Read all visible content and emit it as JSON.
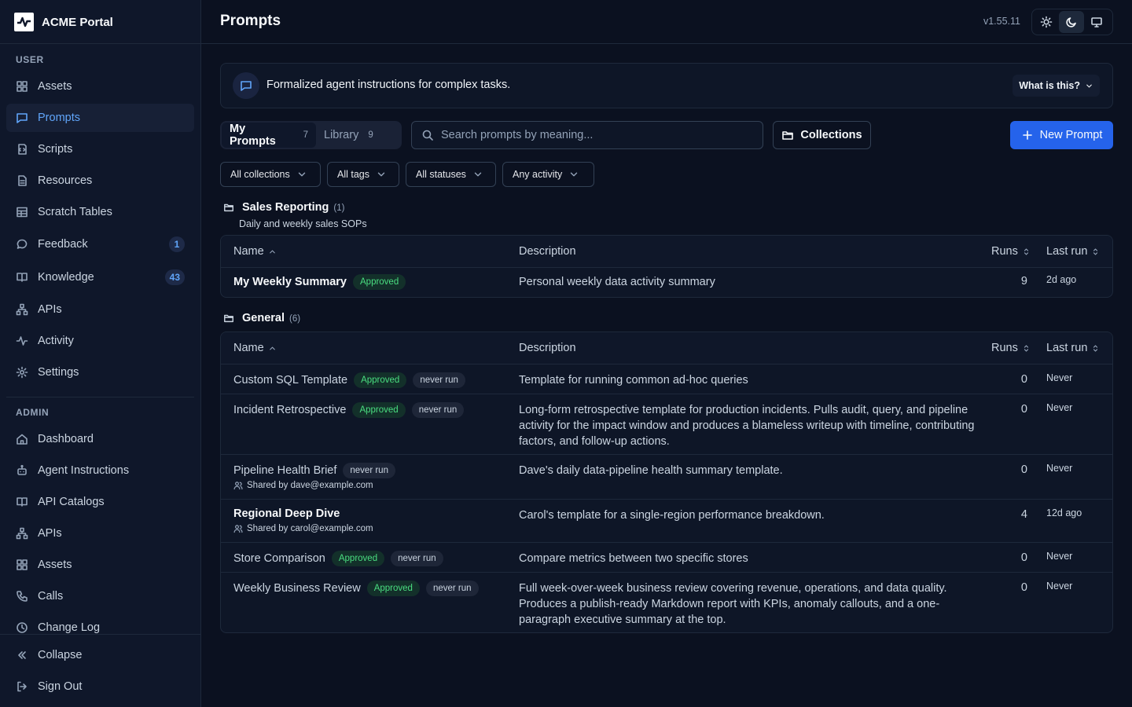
{
  "app": {
    "name": "ACME Portal"
  },
  "sidebar": {
    "user_label": "USER",
    "user_items": [
      {
        "label": "Assets",
        "icon": "grid-icon"
      },
      {
        "label": "Prompts",
        "icon": "message-icon",
        "active": true
      },
      {
        "label": "Scripts",
        "icon": "script-icon"
      },
      {
        "label": "Resources",
        "icon": "file-icon"
      },
      {
        "label": "Scratch Tables",
        "icon": "table-icon"
      },
      {
        "label": "Feedback",
        "icon": "chat-icon",
        "badge": "1"
      },
      {
        "label": "Knowledge",
        "icon": "book-icon",
        "badge": "43"
      },
      {
        "label": "APIs",
        "icon": "network-icon"
      },
      {
        "label": "Activity",
        "icon": "pulse-icon"
      },
      {
        "label": "Settings",
        "icon": "gear-icon"
      }
    ],
    "admin_label": "ADMIN",
    "admin_items": [
      {
        "label": "Dashboard",
        "icon": "home-icon"
      },
      {
        "label": "Agent Instructions",
        "icon": "robot-icon"
      },
      {
        "label": "API Catalogs",
        "icon": "book-icon"
      },
      {
        "label": "APIs",
        "icon": "network-icon"
      },
      {
        "label": "Assets",
        "icon": "grid-icon"
      },
      {
        "label": "Calls",
        "icon": "phone-icon"
      },
      {
        "label": "Change Log",
        "icon": "clock-icon"
      }
    ],
    "collapse_label": "Collapse",
    "signout_label": "Sign Out"
  },
  "header": {
    "title": "Prompts",
    "version": "v1.55.11",
    "theme_active": "dark"
  },
  "banner": {
    "text": "Formalized agent instructions for complex tasks.",
    "help_label": "What is this?"
  },
  "tabs": [
    {
      "label": "My Prompts",
      "count": "7",
      "active": true
    },
    {
      "label": "Library",
      "count": "9",
      "active": false
    }
  ],
  "search": {
    "placeholder": "Search prompts by meaning...",
    "value": ""
  },
  "collections_label": "Collections",
  "new_prompt_label": "New Prompt",
  "filters": [
    "All collections",
    "All tags",
    "All statuses",
    "Any activity"
  ],
  "columns": {
    "name": "Name",
    "description": "Description",
    "runs": "Runs",
    "last_run": "Last run"
  },
  "groups": [
    {
      "name": "Sales Reporting",
      "count": "(1)",
      "subtitle": "Daily and weekly sales SOPs",
      "rows": [
        {
          "name": "My Weekly Summary",
          "bold": true,
          "approved": "Approved",
          "never_run": null,
          "shared": null,
          "description": "Personal weekly data activity summary",
          "runs": "9",
          "last_run": "2d ago"
        }
      ]
    },
    {
      "name": "General",
      "count": "(6)",
      "subtitle": "",
      "rows": [
        {
          "name": "Custom SQL Template",
          "bold": false,
          "approved": "Approved",
          "never_run": "never run",
          "shared": null,
          "description": "Template for running common ad-hoc queries",
          "runs": "0",
          "last_run": "Never"
        },
        {
          "name": "Incident Retrospective",
          "bold": false,
          "approved": "Approved",
          "never_run": "never run",
          "shared": null,
          "description": "Long-form retrospective template for production incidents. Pulls audit, query, and pipeline activity for the impact window and produces a blameless writeup with timeline, contributing factors, and follow-up actions.",
          "runs": "0",
          "last_run": "Never"
        },
        {
          "name": "Pipeline Health Brief",
          "bold": false,
          "approved": null,
          "never_run": "never run",
          "shared": "Shared by dave@example.com",
          "description": "Dave's daily data-pipeline health summary template.",
          "runs": "0",
          "last_run": "Never"
        },
        {
          "name": "Regional Deep Dive",
          "bold": true,
          "approved": null,
          "never_run": null,
          "shared": "Shared by carol@example.com",
          "description": "Carol's template for a single-region performance breakdown.",
          "runs": "4",
          "last_run": "12d ago"
        },
        {
          "name": "Store Comparison",
          "bold": false,
          "approved": "Approved",
          "never_run": "never run",
          "shared": null,
          "description": "Compare metrics between two specific stores",
          "runs": "0",
          "last_run": "Never"
        },
        {
          "name": "Weekly Business Review",
          "bold": false,
          "approved": "Approved",
          "never_run": "never run",
          "shared": null,
          "description": "Full week-over-week business review covering revenue, operations, and data quality. Produces a publish-ready Markdown report with KPIs, anomaly callouts, and a one-paragraph executive summary at the top.",
          "runs": "0",
          "last_run": "Never"
        }
      ]
    }
  ],
  "colors": {
    "accent": "#2563eb",
    "active_nav": "#60a5fa",
    "approved": "#4ade80",
    "background": "#0b1120"
  }
}
